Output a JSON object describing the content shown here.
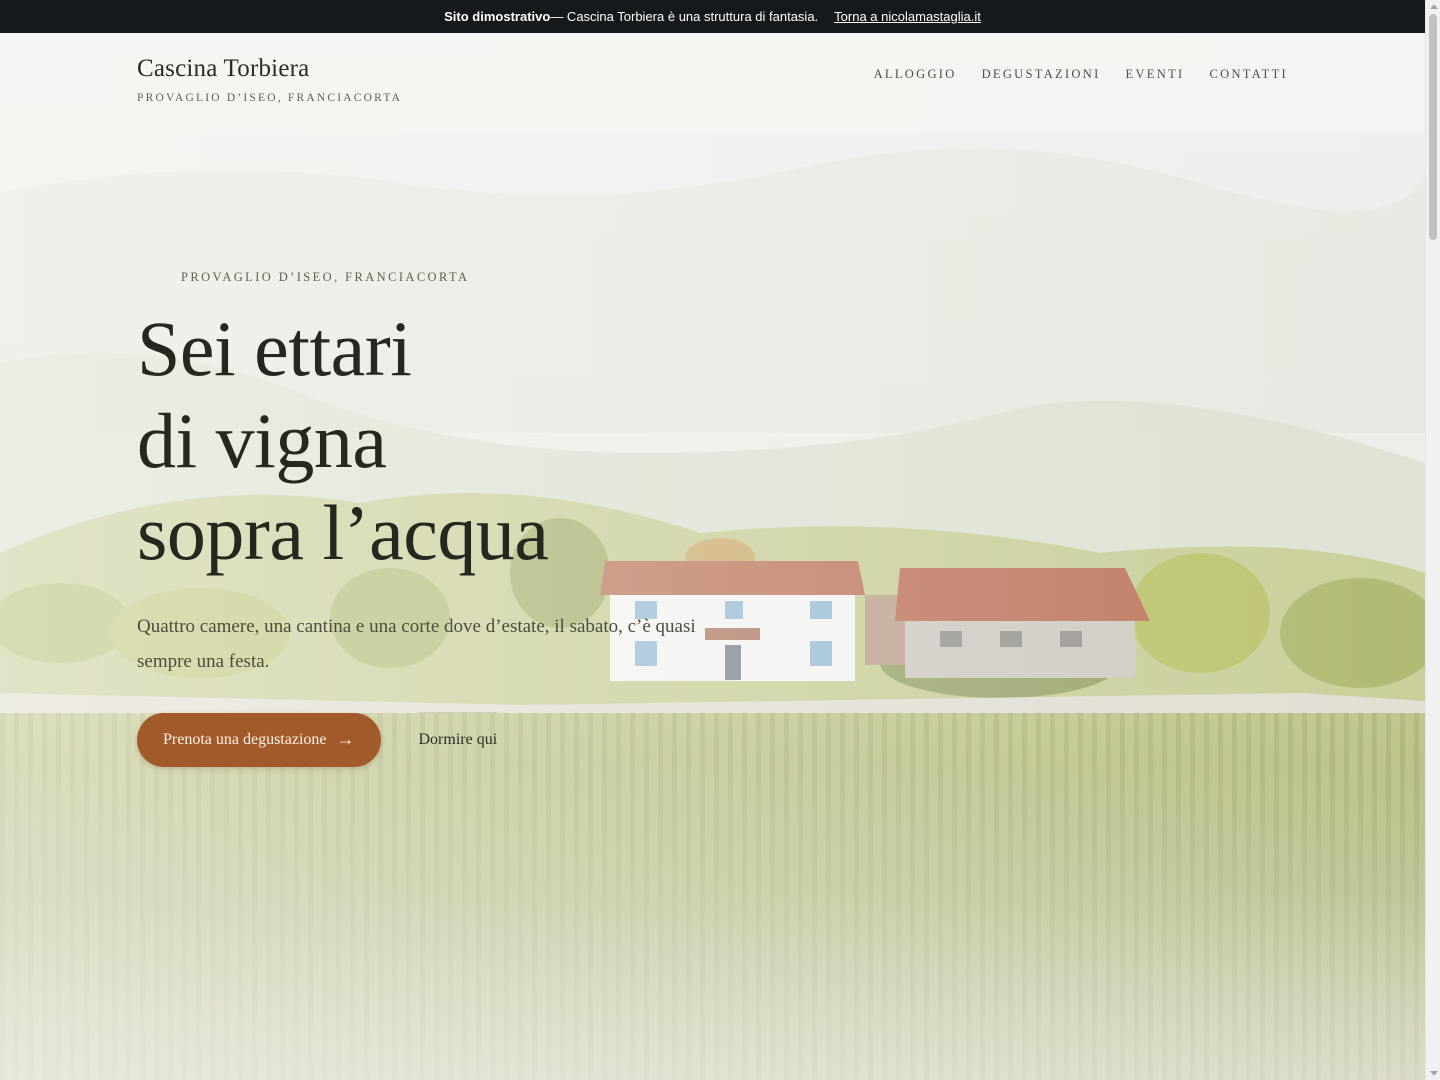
{
  "demo_banner": {
    "strong": "Sito dimostrativo",
    "text": " — Cascina Torbiera è una struttura di fantasia.",
    "link": "Torna a nicolamastaglia.it"
  },
  "header": {
    "brand_name": "Cascina Torbiera",
    "brand_sub": "PROVAGLIO D’ISEO, FRANCIACORTA",
    "nav": [
      "ALLOGGIO",
      "DEGUSTAZIONI",
      "EVENTI",
      "CONTATTI"
    ]
  },
  "hero": {
    "eyebrow": "PROVAGLIO D’ISEO, FRANCIACORTA",
    "headline": [
      "Sei ettari",
      "di vigna",
      "sopra l’acqua"
    ],
    "lead": "Quattro camere, una cantina e una corte dove d’estate, il sabato, c’è quasi sempre una festa.",
    "primary_cta": "Prenota una degustazione",
    "primary_cta_icon": "→",
    "secondary_cta": "Dormire qui",
    "background_image": "farmhouse among vineyards"
  },
  "colors": {
    "demo_bar": "#15191c",
    "accent": "#a35a2a",
    "text_dark": "#27271f",
    "header_bg": "#f6f5f2"
  }
}
